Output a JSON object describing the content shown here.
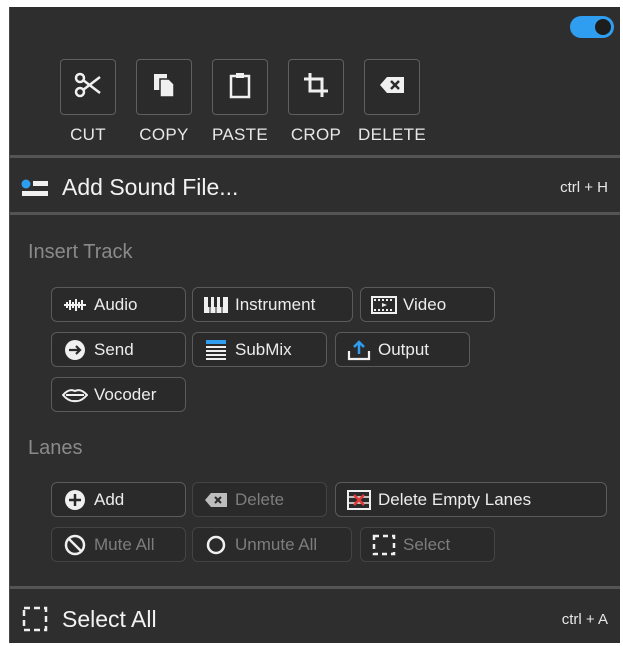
{
  "toggle": {
    "state": "on",
    "color": "#2f9df0"
  },
  "edit_tools": [
    {
      "label": "CUT",
      "icon": "scissors-icon"
    },
    {
      "label": "COPY",
      "icon": "copy-icon"
    },
    {
      "label": "PASTE",
      "icon": "clipboard-icon"
    },
    {
      "label": "CROP",
      "icon": "crop-icon"
    },
    {
      "label": "DELETE",
      "icon": "backspace-icon"
    }
  ],
  "add_sound_file": {
    "label": "Add Sound File...",
    "shortcut": "ctrl + H",
    "icon": "sound-file-icon"
  },
  "insert_track": {
    "title": "Insert Track",
    "buttons": {
      "audio": "Audio",
      "instrument": "Instrument",
      "video": "Video",
      "send": "Send",
      "submix": "SubMix",
      "output": "Output",
      "vocoder": "Vocoder"
    }
  },
  "lanes": {
    "title": "Lanes",
    "buttons": {
      "add": "Add",
      "delete": "Delete",
      "delete_empty": "Delete Empty Lanes",
      "mute_all": "Mute All",
      "unmute_all": "Unmute All",
      "select": "Select"
    }
  },
  "select_all": {
    "label": "Select All",
    "shortcut": "ctrl + A",
    "icon": "selection-icon"
  }
}
